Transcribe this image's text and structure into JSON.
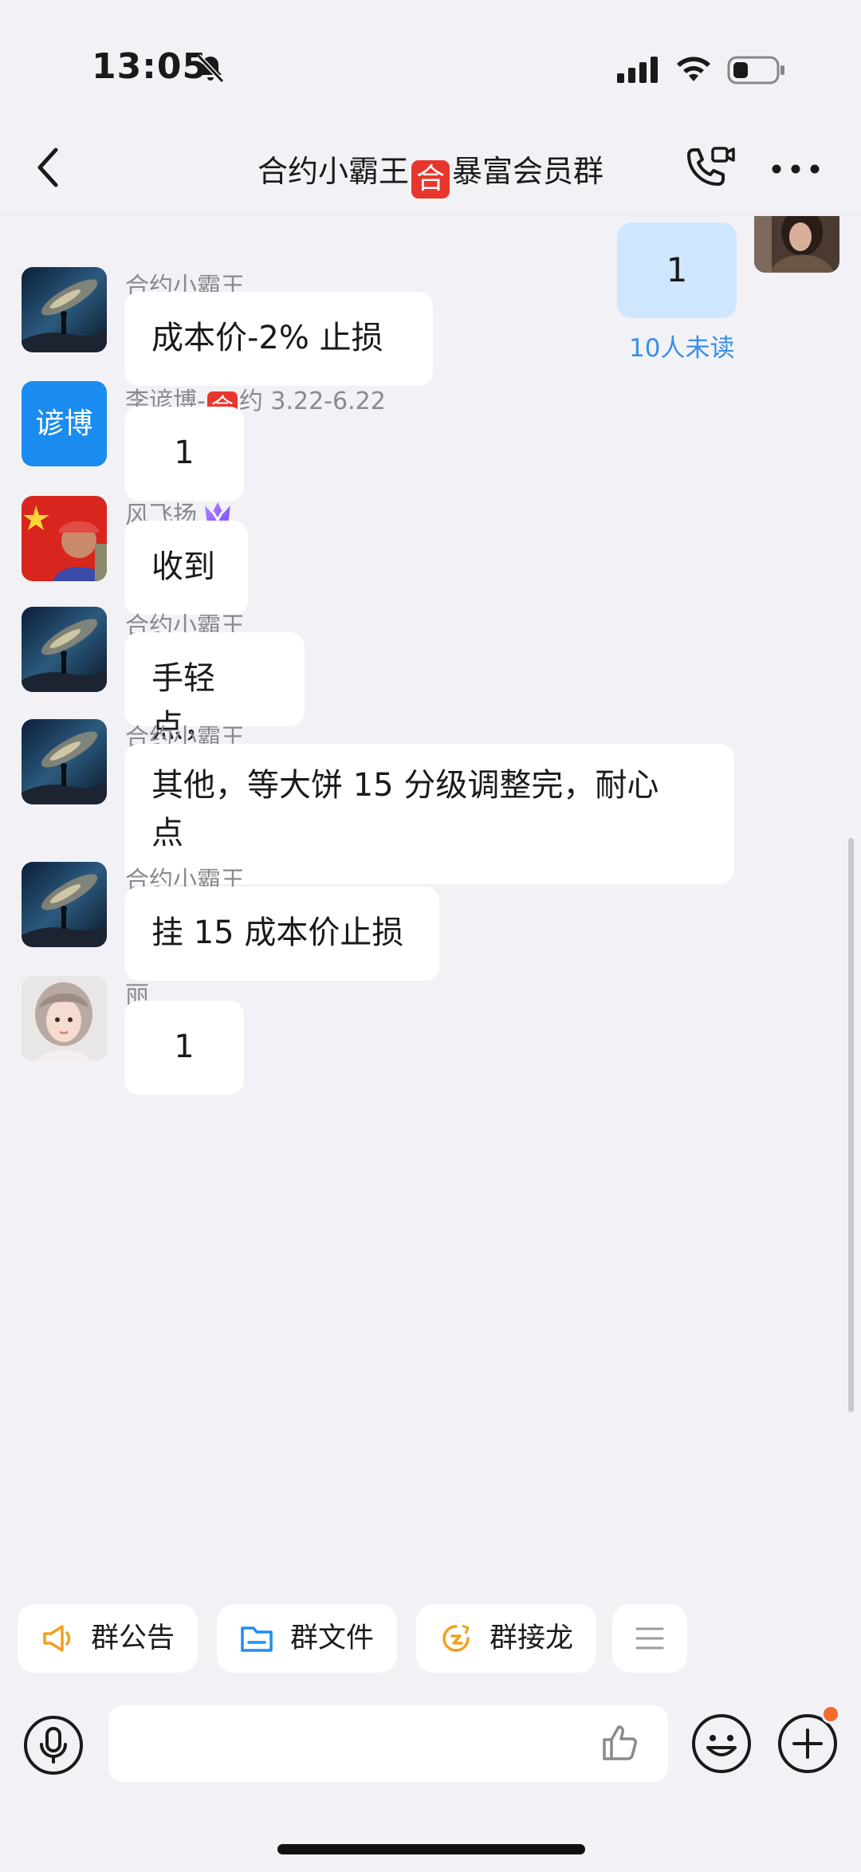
{
  "status_bar": {
    "time": "13:05",
    "icons": [
      "bell-muted-icon",
      "signal-icon",
      "wifi-icon",
      "battery-icon"
    ]
  },
  "header": {
    "title_before": "合约小霸王",
    "title_badge": "合",
    "title_after": "暴富会员群",
    "icons": [
      "back-icon",
      "call-icon",
      "more-icon"
    ]
  },
  "own_message": {
    "text": "1",
    "read_status": "10人未读"
  },
  "messages": [
    {
      "sender": "合约小霸王",
      "text": "成本价-2% 止损",
      "avatar": "galaxy-avatar"
    },
    {
      "sender_prefix": "李谚博-",
      "sender_badge": "合",
      "sender_suffix": "约 3.22-6.22",
      "avatar_text": "谚博",
      "text": "1"
    },
    {
      "sender": "风飞扬",
      "text": "收到",
      "avatar": "flag-avatar",
      "badge_icon": "vip-crown-icon"
    },
    {
      "sender": "合约小霸王",
      "text": "手轻点，",
      "avatar": "galaxy-avatar"
    },
    {
      "sender": "合约小霸王",
      "text_line1": "其他，等大饼 15 分级调整完，耐心",
      "text_line2": "点",
      "avatar": "galaxy-avatar"
    },
    {
      "sender": "合约小霸王",
      "text": "挂 15 成本价止损",
      "avatar": "galaxy-avatar"
    },
    {
      "sender": "丽",
      "text": "1",
      "avatar": "girl-avatar"
    }
  ],
  "tools": {
    "announcement": "群公告",
    "files": "群文件",
    "relay": "群接龙",
    "icons": [
      "megaphone-icon",
      "folder-icon",
      "relay-icon",
      "menu-icon"
    ]
  },
  "input_bar": {
    "placeholder": "",
    "icons": [
      "voice-icon",
      "thumbs-up-icon",
      "emoji-icon",
      "plus-icon"
    ]
  },
  "colors": {
    "background": "#f2f2f6",
    "own_bubble": "#cfe6ff",
    "badge_red": "#e8362d",
    "read_blue": "#3a8ee6",
    "notify_orange": "#f26b2f"
  }
}
